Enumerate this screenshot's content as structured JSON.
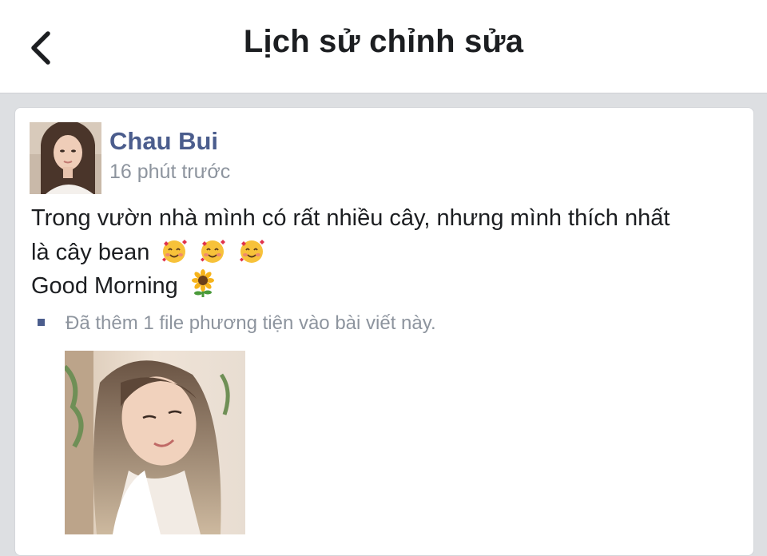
{
  "header": {
    "title": "Lịch sử chỉnh sửa",
    "back_icon": "chevron-left-icon"
  },
  "post": {
    "author": "Chau Bui",
    "time": "16 phút trước",
    "text_line1": "Trong vườn nhà mình có rất nhiều cây, nhưng mình thích nhất",
    "text_line2": "là cây bean",
    "text_line3": "Good Morning",
    "emojis_line2": [
      "smiling-face-with-hearts",
      "smiling-face-with-hearts",
      "smiling-face-with-hearts"
    ],
    "emoji_line3": "sunflower",
    "edit_note": "Đã thêm 1 file phương tiện vào bài viết này.",
    "accent_color": "#4b5d8d"
  }
}
